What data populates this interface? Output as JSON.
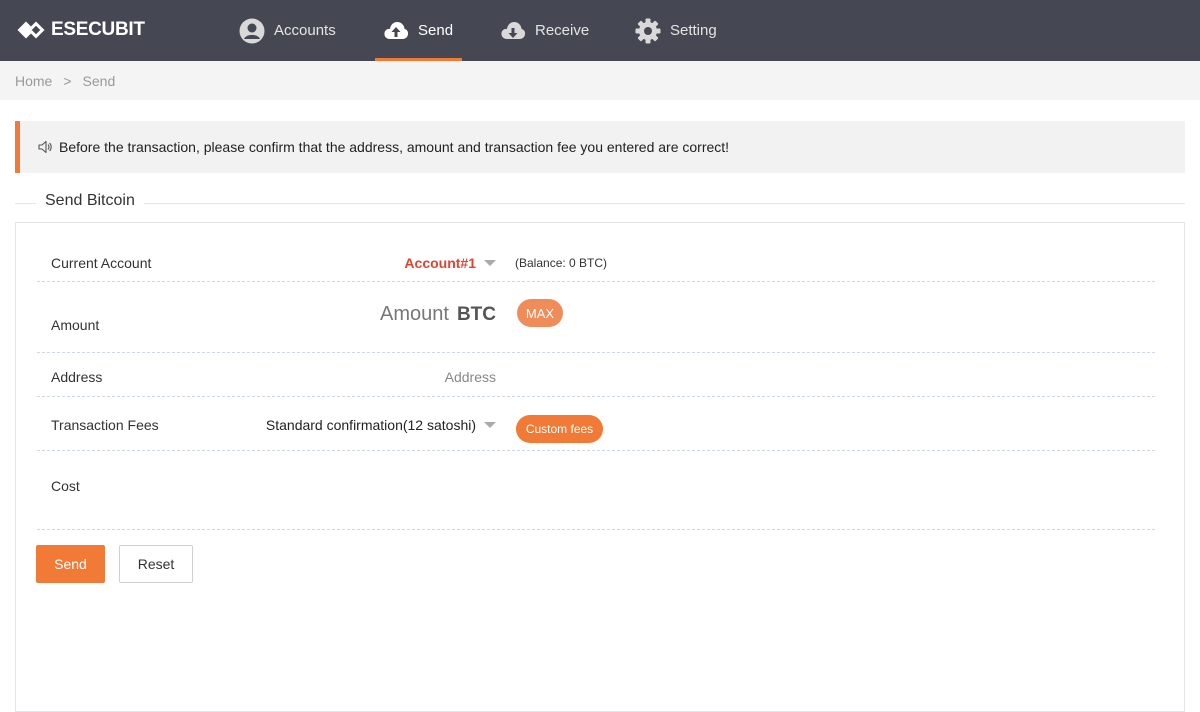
{
  "app": {
    "brand": "ESECUBIT"
  },
  "nav": {
    "accounts": "Accounts",
    "send": "Send",
    "receive": "Receive",
    "setting": "Setting"
  },
  "breadcrumb": {
    "home": "Home",
    "separator": ">",
    "current": "Send"
  },
  "notice": {
    "text": "Before the transaction, please confirm that the address, amount and transaction fee you entered are correct!"
  },
  "form": {
    "legend": "Send Bitcoin",
    "current_account": {
      "label": "Current Account",
      "value": "Account#1",
      "balance": "(Balance: 0 BTC)"
    },
    "amount": {
      "label": "Amount",
      "placeholder": "Amount",
      "unit": "BTC",
      "max_label": "MAX"
    },
    "address": {
      "label": "Address",
      "placeholder": "Address"
    },
    "fees": {
      "label": "Transaction Fees",
      "value": "Standard confirmation(12 satoshi)",
      "custom_label": "Custom fees"
    },
    "cost": {
      "label": "Cost",
      "value": ""
    }
  },
  "actions": {
    "send": "Send",
    "reset": "Reset"
  },
  "colors": {
    "topbar": "#454852",
    "accent": "#f07a36",
    "account_red": "#e0442e"
  },
  "icons": {
    "accounts": "user-avatar-icon",
    "send": "cloud-upload-icon",
    "receive": "cloud-download-icon",
    "setting": "gear-icon",
    "notice": "speaker-icon"
  }
}
